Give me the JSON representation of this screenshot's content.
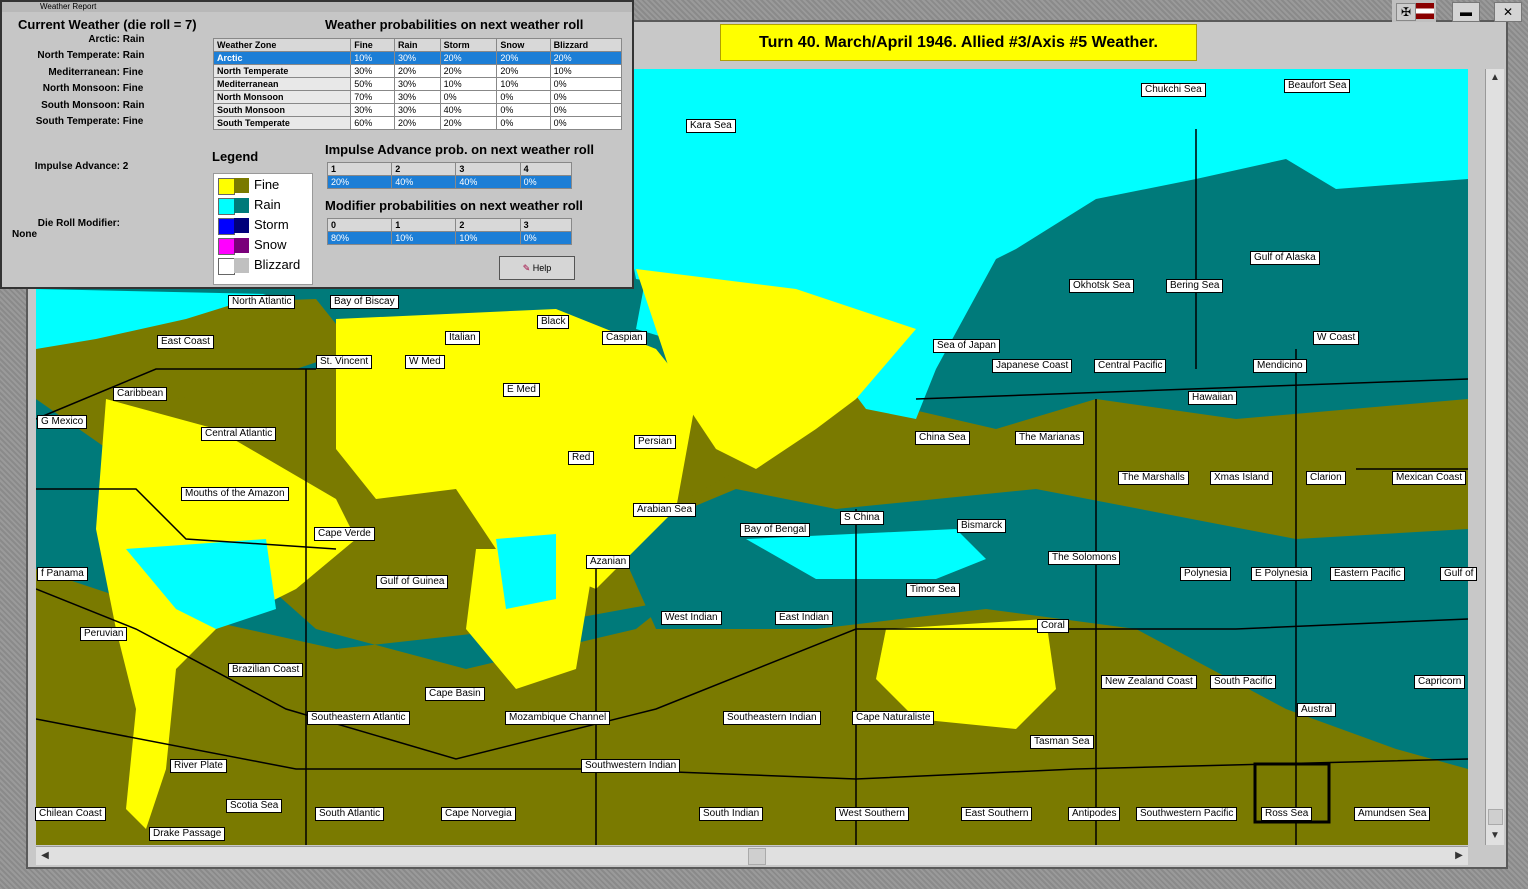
{
  "window_title": "Weather Report",
  "current_weather": {
    "heading": "Current Weather (die roll = 7)",
    "zones": [
      {
        "label": "Arctic:",
        "value": "Rain"
      },
      {
        "label": "North Temperate:",
        "value": "Rain"
      },
      {
        "label": "Mediterranean:",
        "value": "Fine"
      },
      {
        "label": "North Monsoon:",
        "value": "Fine"
      },
      {
        "label": "South Monsoon:",
        "value": "Rain"
      },
      {
        "label": "South Temperate:",
        "value": "Fine"
      }
    ],
    "impulse_advance_label": "Impulse Advance:",
    "impulse_advance_value": "2",
    "die_roll_modifier_label": "Die Roll Modifier:",
    "die_roll_modifier_value": "None"
  },
  "probabilities": {
    "heading": "Weather probabilities on next weather roll",
    "columns": [
      "Weather Zone",
      "Fine",
      "Rain",
      "Storm",
      "Snow",
      "Blizzard"
    ],
    "rows": [
      {
        "zone": "Arctic",
        "cells": [
          "10%",
          "30%",
          "20%",
          "20%",
          "20%"
        ]
      },
      {
        "zone": "North Temperate",
        "cells": [
          "30%",
          "20%",
          "20%",
          "20%",
          "10%"
        ]
      },
      {
        "zone": "Mediterranean",
        "cells": [
          "50%",
          "30%",
          "10%",
          "10%",
          "0%"
        ]
      },
      {
        "zone": "North Monsoon",
        "cells": [
          "70%",
          "30%",
          "0%",
          "0%",
          "0%"
        ]
      },
      {
        "zone": "South Monsoon",
        "cells": [
          "30%",
          "30%",
          "40%",
          "0%",
          "0%"
        ]
      },
      {
        "zone": "South Temperate",
        "cells": [
          "60%",
          "20%",
          "20%",
          "0%",
          "0%"
        ]
      }
    ]
  },
  "impulse_table": {
    "heading": "Impulse Advance prob. on next weather roll",
    "columns": [
      "1",
      "2",
      "3",
      "4"
    ],
    "values": [
      "20%",
      "40%",
      "40%",
      "0%"
    ]
  },
  "modifier_table": {
    "heading": "Modifier probabilities on next weather roll",
    "columns": [
      "0",
      "1",
      "2",
      "3"
    ],
    "values": [
      "80%",
      "10%",
      "10%",
      "0%"
    ]
  },
  "legend": {
    "heading": "Legend",
    "items": [
      {
        "label": "Fine",
        "c1": "#ffff00",
        "c2": "#7a7a00"
      },
      {
        "label": "Rain",
        "c1": "#00ffff",
        "c2": "#007a7a"
      },
      {
        "label": "Storm",
        "c1": "#0000ff",
        "c2": "#00007a"
      },
      {
        "label": "Snow",
        "c1": "#ff00ff",
        "c2": "#7a007a"
      },
      {
        "label": "Blizzard",
        "c1": "#ffffff",
        "c2": "#c0c0c0"
      }
    ]
  },
  "help_button": "Help",
  "banner": "Turn 40.  March/April 1946.  Allied #3/Axis #5  Weather.",
  "colors": {
    "fine_land": "#ffff00",
    "fine_sea": "#7a7a00",
    "rain_land": "#00ffff",
    "rain_sea": "#007a7a"
  },
  "sea_areas": [
    "Chukchi Sea",
    "Beaufort Sea",
    "Kara Sea",
    "Gulf of Alaska",
    "Okhotsk Sea",
    "Bering Sea",
    "North Atlantic",
    "Bay of Biscay",
    "Black",
    "Caspian",
    "Italian",
    "East Coast",
    "St. Vincent",
    "W Med",
    "Sea of Japan",
    "Japanese Coast",
    "Central Pacific",
    "W Coast",
    "Caribbean",
    "E Med",
    "Mendicino",
    "Hawaiian",
    "G Mexico",
    "Central Atlantic",
    "Persian",
    "China Sea",
    "The Marianas",
    "Red",
    "The Marshalls",
    "Xmas Island",
    "Clarion",
    "Mexican Coast",
    "Mouths of the Amazon",
    "Arabian Sea",
    "S China",
    "Bismarck",
    "Bay of Bengal",
    "Cape Verde",
    "Azanian",
    "The Solomons",
    "f Panama",
    "Gulf of Guinea",
    "Polynesia",
    "E Polynesia",
    "Eastern Pacific",
    "Gulf of",
    "Timor Sea",
    "West Indian",
    "East Indian",
    "Peruvian",
    "Coral",
    "Brazilian Coast",
    "New Zealand Coast",
    "South Pacific",
    "Capricorn",
    "Cape Basin",
    "Southeastern Atlantic",
    "Mozambique Channel",
    "Southeastern Indian",
    "Cape Naturaliste",
    "Austral",
    "Tasman Sea",
    "River Plate",
    "Southwestern Indian",
    "Scotia Sea",
    "Chilean Coast",
    "South Atlantic",
    "Cape Norvegia",
    "South Indian",
    "West Southern",
    "East Southern",
    "Antipodes",
    "Southwestern Pacific",
    "Ross Sea",
    "Amundsen Sea",
    "Drake Passage"
  ]
}
